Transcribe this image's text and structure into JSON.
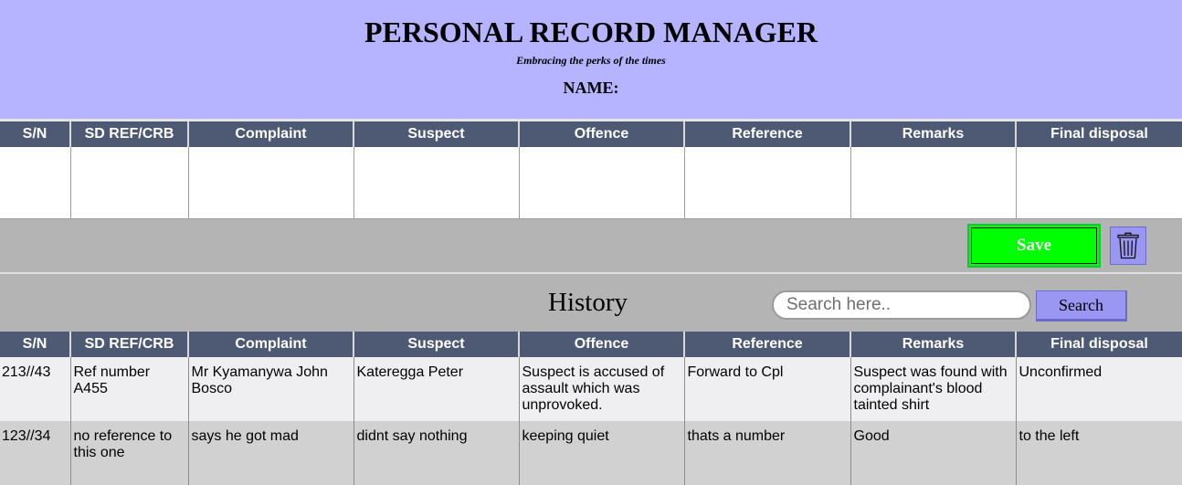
{
  "header": {
    "title": "PERSONAL RECORD MANAGER",
    "tagline": "Embracing the perks of the times",
    "name_label": "NAME:"
  },
  "columns": [
    "S/N",
    "SD REF/CRB",
    "Complaint",
    "Suspect",
    "Offence",
    "Reference",
    "Remarks",
    "Final disposal"
  ],
  "actions": {
    "save_label": "Save",
    "delete_icon": "trash-icon"
  },
  "history": {
    "title": "History",
    "search_placeholder": "Search here..",
    "search_button": "Search",
    "rows": [
      {
        "sn": "213//43",
        "ref": "Ref number A455",
        "complaint": "Mr Kyamanywa John Bosco",
        "suspect": "Kateregga Peter",
        "offence": "Suspect is accused of assault which was unprovoked.",
        "reference": "Forward to Cpl",
        "remarks": "Suspect was found with complainant's blood tainted shirt",
        "disposal": "Unconfirmed"
      },
      {
        "sn": "123//34",
        "ref": "no reference to this one",
        "complaint": "says he got mad",
        "suspect": "didnt say nothing",
        "offence": "keeping quiet",
        "reference": "thats a number",
        "remarks": "Good",
        "disposal": "to the left"
      }
    ]
  },
  "colors": {
    "header_bg": "#b6b4ff",
    "table_header_bg": "#4e5a73",
    "bar_bg": "#b4b4b4",
    "save_bg": "#00ff00",
    "accent_button": "#9a97f2"
  }
}
